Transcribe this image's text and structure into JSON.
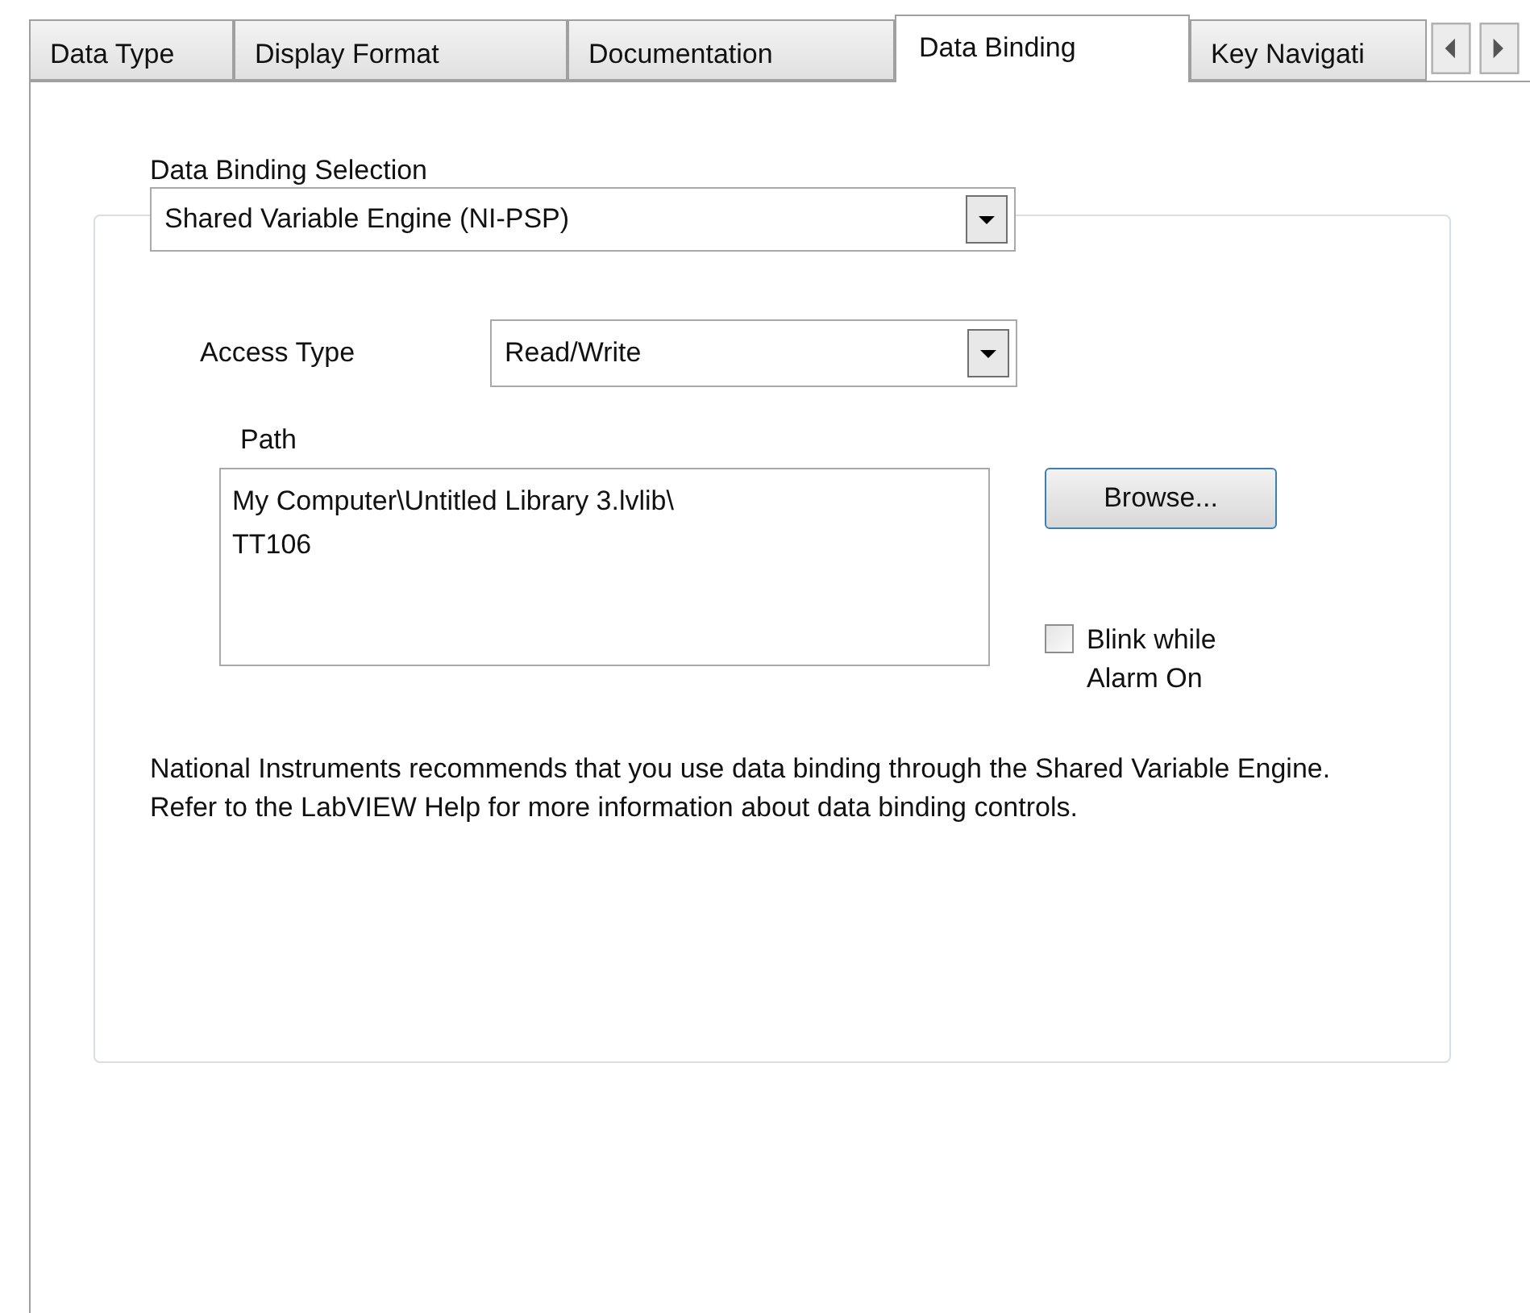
{
  "tabs": [
    {
      "label": "Data Type",
      "selected": false
    },
    {
      "label": "Display Format",
      "selected": false
    },
    {
      "label": "Documentation",
      "selected": false
    },
    {
      "label": "Data Binding",
      "selected": true
    },
    {
      "label": "Key Navigati",
      "selected": false
    }
  ],
  "binding_selection": {
    "label": "Data Binding Selection",
    "value": "Shared Variable Engine (NI-PSP)"
  },
  "access_type": {
    "label": "Access Type",
    "value": "Read/Write"
  },
  "path": {
    "label": "Path",
    "value": "My Computer\\Untitled Library 3.lvlib\\\nTT106"
  },
  "browse_button": "Browse...",
  "blink_checkbox": {
    "label": "Blink while\nAlarm On",
    "checked": false
  },
  "note": "National Instruments recommends that you use data binding through the Shared Variable Engine.  Refer to the LabVIEW Help for more information about data binding controls."
}
